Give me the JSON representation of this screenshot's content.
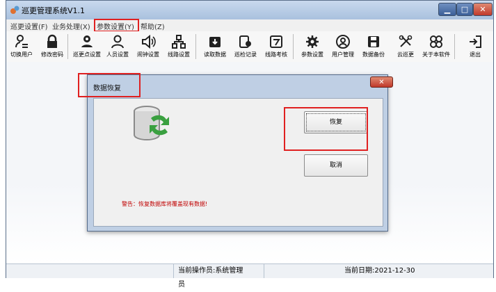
{
  "window": {
    "title": "巡更管理系统V1.1",
    "controls": {
      "minimize": "▁",
      "maximize": "□",
      "close": "✕"
    }
  },
  "menu": [
    "巡更设置(F)",
    "业务处理(X)",
    "参数设置(Y)",
    "帮助(Z)"
  ],
  "toolbar": [
    {
      "label": "切换用户",
      "icon": "switch-user-icon"
    },
    {
      "label": "修改密码",
      "icon": "lock-icon"
    },
    {
      "label": "巡更点设置",
      "icon": "location-person-icon"
    },
    {
      "label": "人员设置",
      "icon": "users-icon"
    },
    {
      "label": "闹钟设置",
      "icon": "speaker-icon"
    },
    {
      "label": "线路设置",
      "icon": "route-icon"
    },
    {
      "label": "读取数据",
      "icon": "download-icon"
    },
    {
      "label": "巡检记录",
      "icon": "record-icon"
    },
    {
      "label": "线路考核",
      "icon": "check-icon"
    },
    {
      "label": "参数设置",
      "icon": "gear-icon"
    },
    {
      "label": "用户管理",
      "icon": "user-manage-icon"
    },
    {
      "label": "数据备份",
      "icon": "save-icon"
    },
    {
      "label": "云巡更",
      "icon": "tools-icon"
    },
    {
      "label": "关于本软件",
      "icon": "about-icon"
    },
    {
      "label": "退出",
      "icon": "exit-icon"
    }
  ],
  "dialog": {
    "title": "数据恢复",
    "close": "✕",
    "restore_button": "恢复",
    "cancel_button": "取消",
    "warning": "警告：恢复数据库将覆盖现有数据!"
  },
  "status": {
    "operator": "当前操作员:系统管理员",
    "date": "当前日期:2021-12-30"
  },
  "colors": {
    "highlight": "#e02020",
    "warning": "#c00000",
    "arrow_green": "#3aa040"
  }
}
